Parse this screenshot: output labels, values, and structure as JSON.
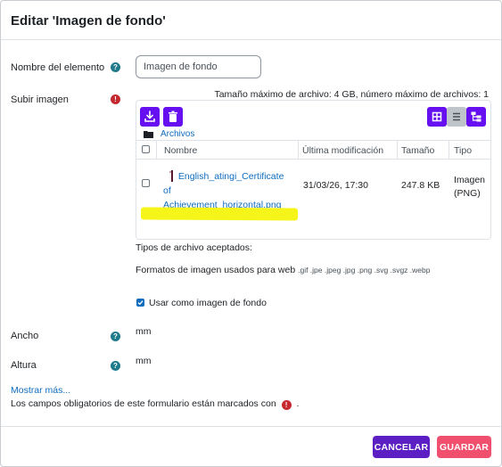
{
  "modal": {
    "title": "Editar 'Imagen de fondo'"
  },
  "fields": {
    "name_label": "Nombre del elemento",
    "name_value": "Imagen de fondo",
    "upload_label": "Subir imagen",
    "width_label": "Ancho",
    "width_unit": "mm",
    "height_label": "Altura",
    "height_unit": "mm"
  },
  "filepicker": {
    "max_size_text": "Tamaño máximo de archivo: 4 GB, número máximo de archivos: 1",
    "breadcrumb": "Archivos",
    "columns": {
      "name": "Nombre",
      "modified": "Última modificación",
      "size": "Tamaño",
      "type": "Tipo"
    },
    "files": [
      {
        "name_line1": "English_atingi_Certificate",
        "name_line2": "of",
        "name_line3": "Achievement_horizontal.png",
        "modified": "31/03/26, 17:30",
        "size": "247.8 KB",
        "type_line1": "Imagen",
        "type_line2": "(PNG)"
      }
    ],
    "icons": [
      "download-icon",
      "trash-icon",
      "grid-view-icon",
      "list-view-icon",
      "tree-view-icon",
      "folder-icon"
    ]
  },
  "accepted": {
    "title": "Tipos de archivo aceptados:",
    "formats_label": "Formatos de imagen usados para web",
    "formats_list": ".gif .jpe .jpeg .jpg .png .svg .svgz .webp"
  },
  "use_as_background": {
    "label": "Usar como imagen de fondo",
    "checked": true
  },
  "show_more": "Mostrar más...",
  "required_note": {
    "before": "Los campos obligatorios de este formulario están marcados con",
    "after": "."
  },
  "buttons": {
    "cancel": "CANCELAR",
    "save": "GUARDAR"
  },
  "colors": {
    "primary": "#6610f2",
    "cancel": "#5b1fc4",
    "save": "#f0506e",
    "link": "#0f6cbf",
    "help": "#1f7a8c",
    "required": "#c5282f",
    "highlight": "#f5f51a"
  }
}
